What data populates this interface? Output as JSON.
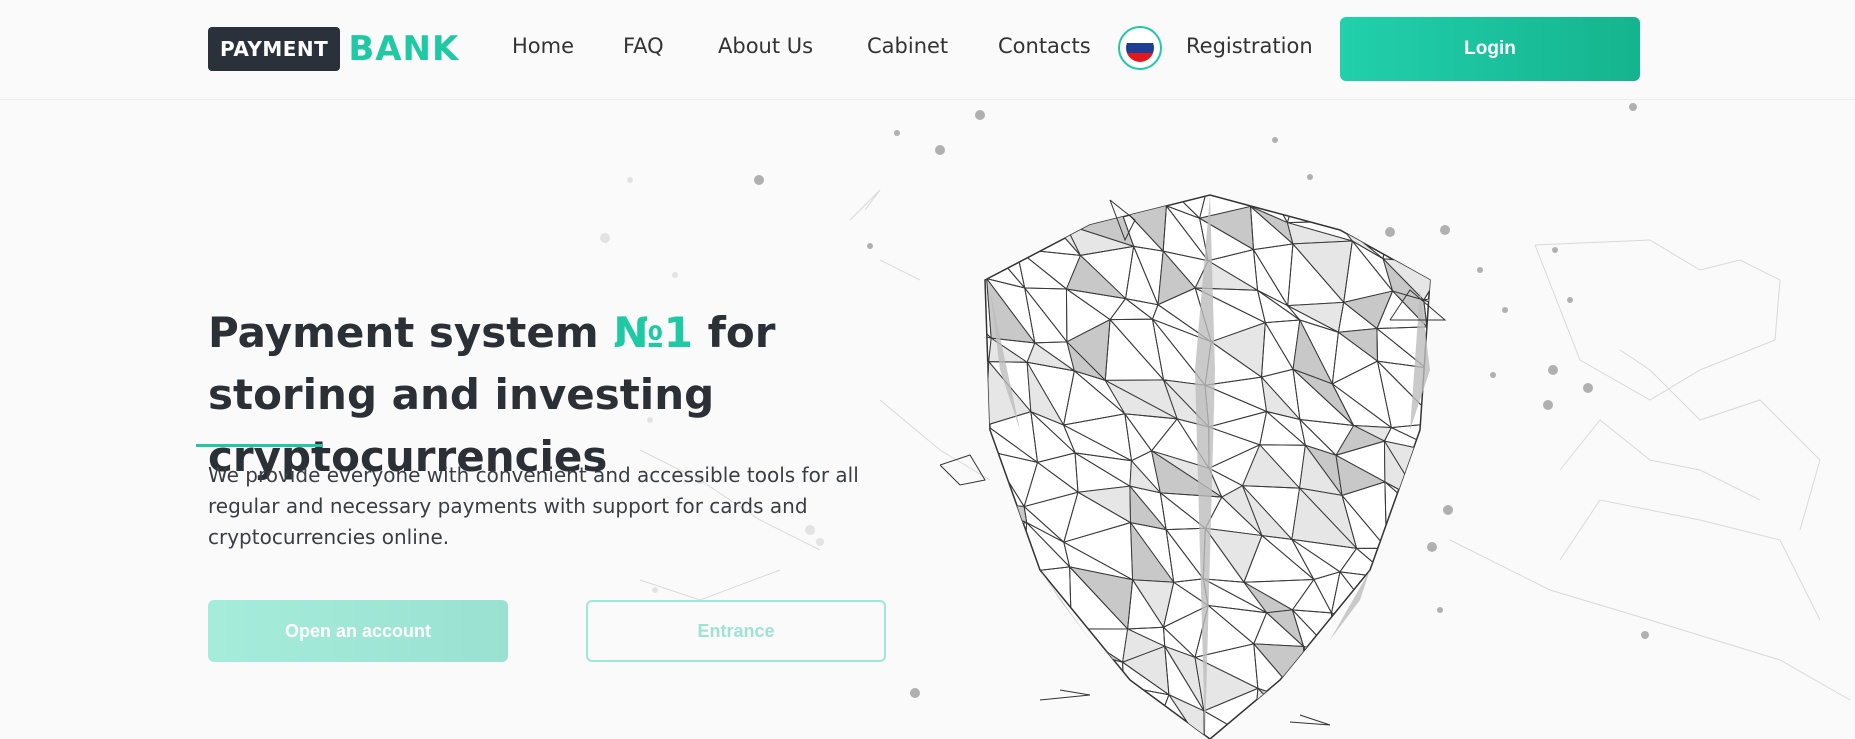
{
  "header": {
    "logo_box": "PAYMENT",
    "logo_word": "BANK",
    "nav": [
      "Home",
      "FAQ",
      "About Us",
      "Cabinet",
      "Contacts",
      "Registration"
    ],
    "language_icon": "russia-flag-icon",
    "login_label": "Login"
  },
  "hero": {
    "title_part1": "Payment system ",
    "title_accent": "№1",
    "title_part2": " for storing and investing cryptocurrencies",
    "description": "We provide everyone with convenient and accessible tools for all regular and necessary payments with support for cards and cryptocurrencies online.",
    "open_account_label": "Open an account",
    "entrance_label": "Entrance"
  },
  "colors": {
    "accent": "#1fc9a3",
    "dark": "#2a313b"
  }
}
